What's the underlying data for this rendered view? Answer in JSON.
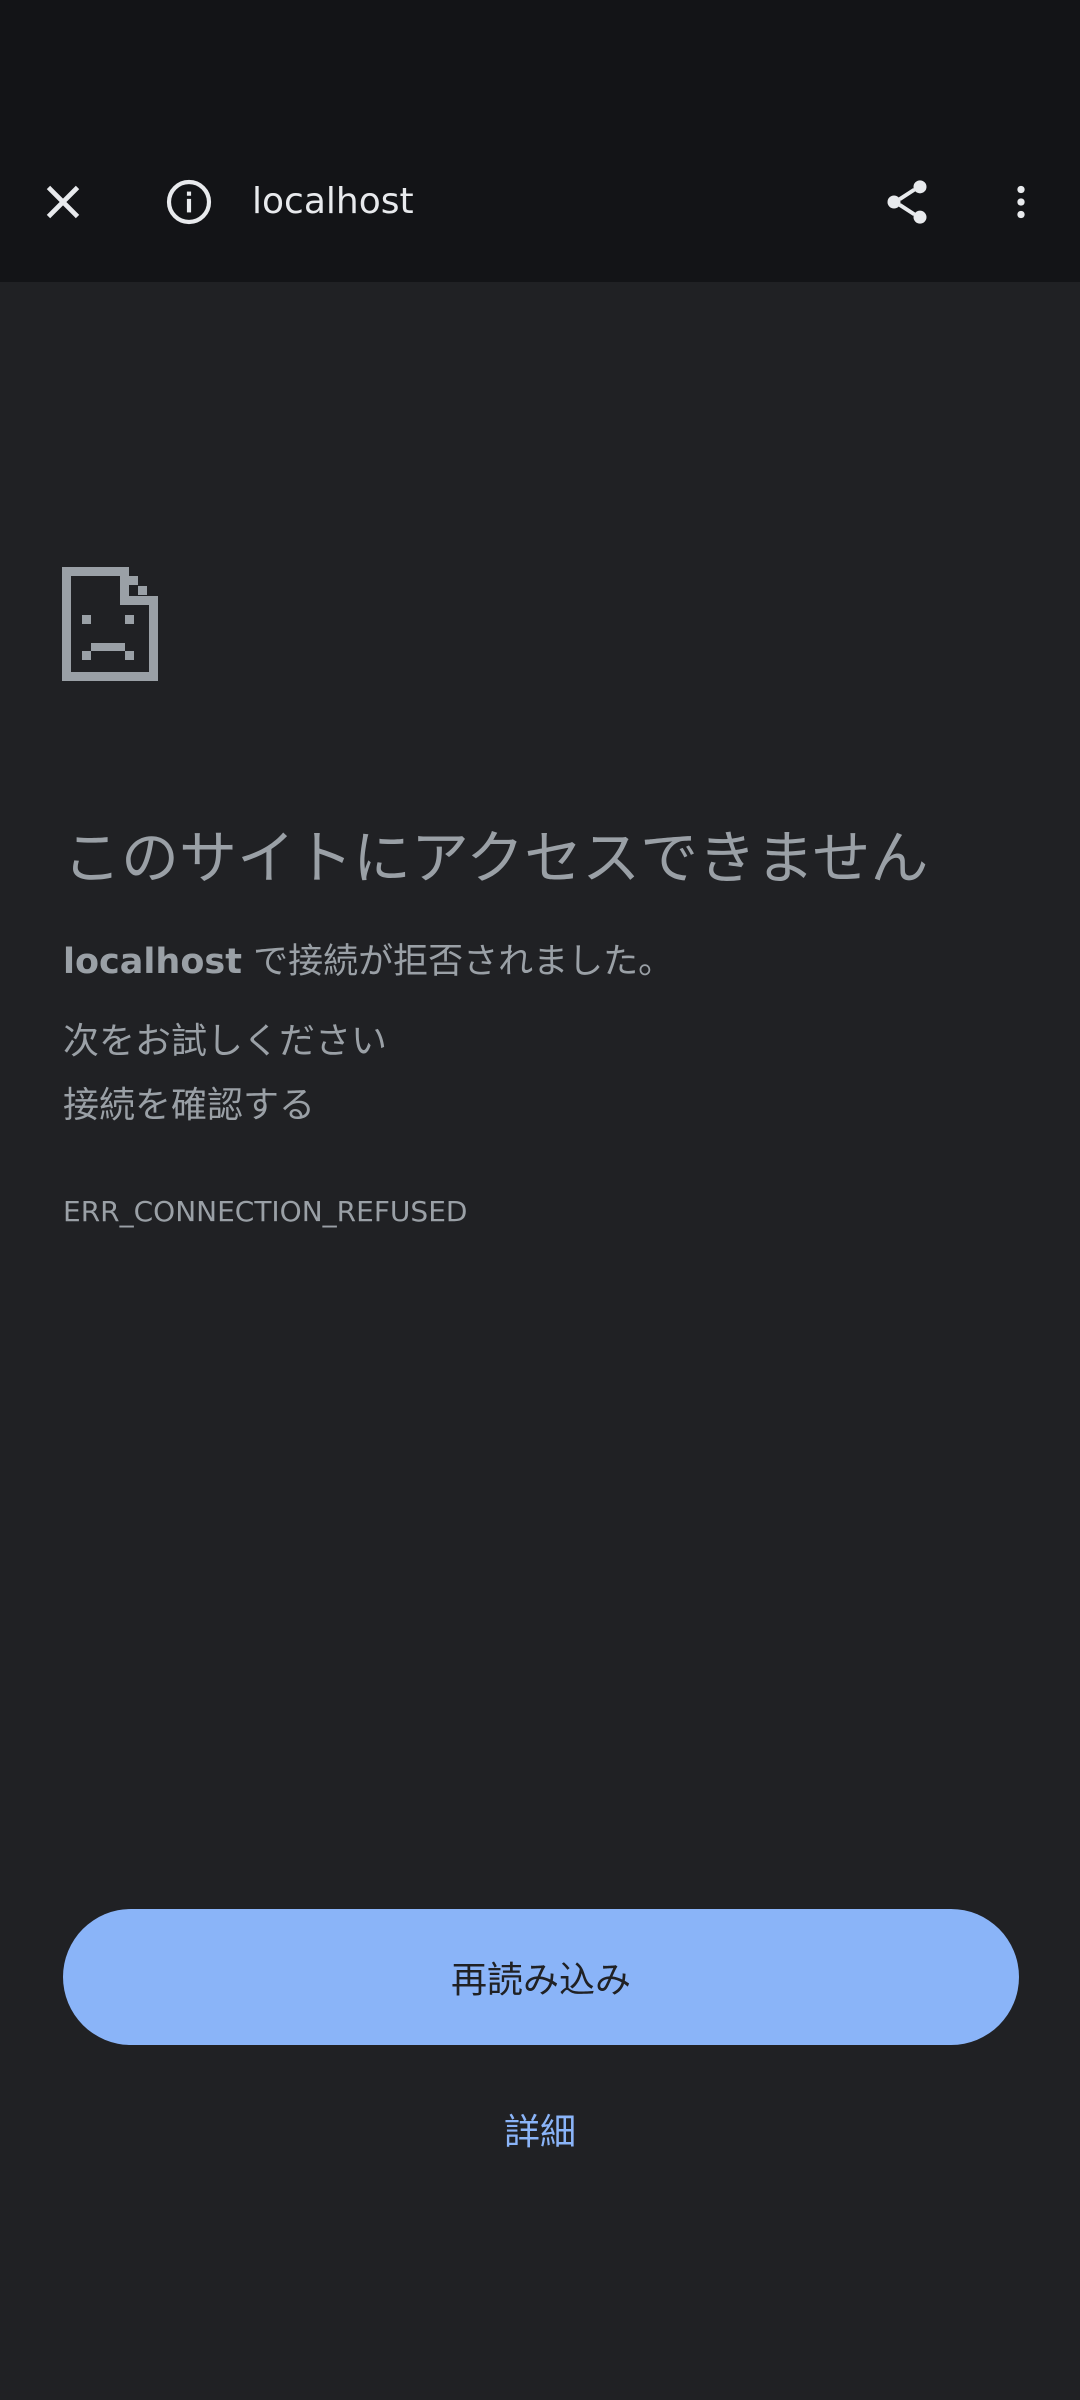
{
  "toolbar": {
    "url": "localhost",
    "icons": {
      "close": "close-icon",
      "info": "info-icon",
      "share": "share-icon",
      "more": "more-vert-icon"
    }
  },
  "error_page": {
    "icon": "sad-document-icon",
    "heading": "このサイトにアクセスできません",
    "message_host": "localhost",
    "message_rest": " で接続が拒否されました。",
    "suggestion_title": "次をお試しください",
    "suggestion_item": "接続を確認する",
    "error_code": "ERR_CONNECTION_REFUSED",
    "reload_label": "再読み込み",
    "details_label": "詳細"
  },
  "colors": {
    "toolbar_bg": "#131417",
    "page_bg": "#202124",
    "text_secondary": "#9aa0a6",
    "text_primary": "#e8eaed",
    "accent": "#8ab4f8"
  }
}
